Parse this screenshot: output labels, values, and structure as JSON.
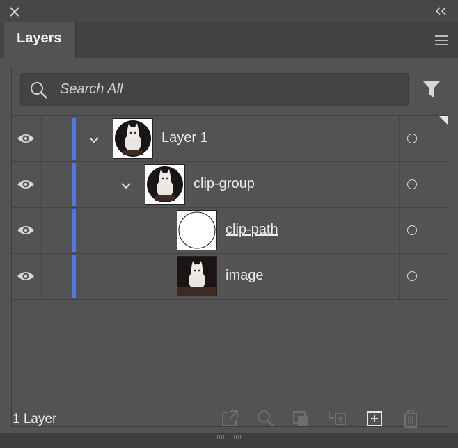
{
  "panel": {
    "tab_label": "Layers"
  },
  "search": {
    "placeholder": "Search All"
  },
  "layers": [
    {
      "name": "Layer 1",
      "level": 0,
      "expanded": true,
      "underlined": false
    },
    {
      "name": "clip-group",
      "level": 1,
      "expanded": true,
      "underlined": false
    },
    {
      "name": "clip-path",
      "level": 2,
      "expanded": false,
      "underlined": true
    },
    {
      "name": "image",
      "level": 2,
      "expanded": false,
      "underlined": false
    }
  ],
  "footer": {
    "layer_count": "1 Layer"
  },
  "colors": {
    "layer_color_bar": "#4f78e6",
    "panel_bg": "#535353"
  },
  "icons": {
    "close": "close-icon",
    "collapse": "double-chevron-left-icon",
    "menu": "hamburger-menu-icon",
    "search": "search-icon",
    "filter": "filter-funnel-icon",
    "visibility": "eye-icon",
    "target": "target-circle-icon",
    "bottom_actions": [
      "export-icon",
      "locate-object-icon",
      "make-clipping-mask-icon",
      "create-sublayer-icon",
      "new-layer-icon",
      "trash-icon"
    ]
  }
}
